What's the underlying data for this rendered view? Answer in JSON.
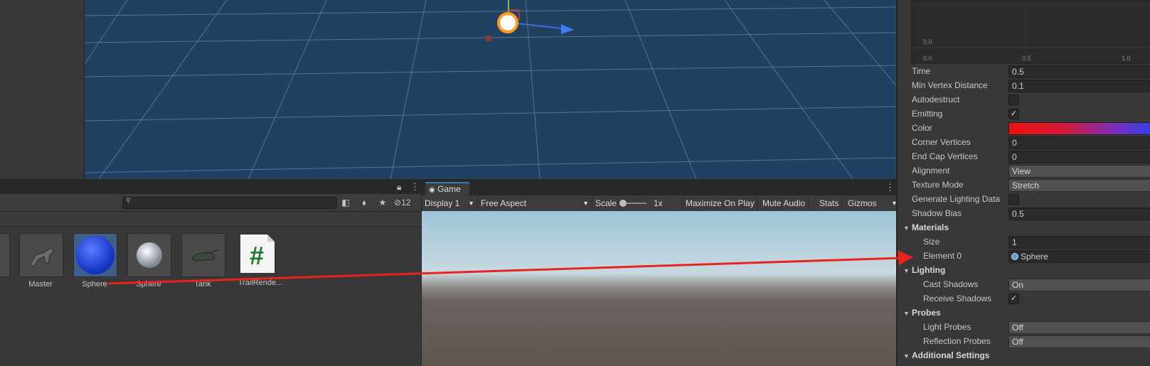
{
  "project": {
    "search": {
      "placeholder": ""
    },
    "toolbar": {
      "hidden_count": "12"
    },
    "assets": [
      {
        "name": "Master",
        "icon": "model-icon"
      },
      {
        "name": "Sphere",
        "icon": "material-sphere-blue-icon"
      },
      {
        "name": "Sphere",
        "icon": "material-sphere-white-icon"
      },
      {
        "name": "Tank",
        "icon": "model-tank-icon"
      },
      {
        "name": "TrailRende...",
        "icon": "script-icon"
      }
    ]
  },
  "game": {
    "tab_label": "Game",
    "display": "Display 1",
    "aspect": "Free Aspect",
    "scale_label": "Scale",
    "scale_value": "1x",
    "maximize": "Maximize On Play",
    "mute": "Mute Audio",
    "stats": "Stats",
    "gizmos": "Gizmos"
  },
  "inspector": {
    "curve": {
      "y_labels": [
        "0.0"
      ],
      "x_labels": [
        "0.0",
        "0.5",
        "1.0"
      ]
    },
    "time": {
      "label": "Time",
      "value": "0.5"
    },
    "min_vertex_distance": {
      "label": "Min Vertex Distance",
      "value": "0.1"
    },
    "autodestruct": {
      "label": "Autodestruct",
      "checked": false
    },
    "emitting": {
      "label": "Emitting",
      "checked": true,
      "mark": "✓"
    },
    "color": {
      "label": "Color",
      "gradient_start": "#ee1111",
      "gradient_end": "#2244ee"
    },
    "corner_vertices": {
      "label": "Corner Vertices",
      "value": "0"
    },
    "end_cap_vertices": {
      "label": "End Cap Vertices",
      "value": "0"
    },
    "alignment": {
      "label": "Alignment",
      "value": "View"
    },
    "texture_mode": {
      "label": "Texture Mode",
      "value": "Stretch"
    },
    "generate_lighting_data": {
      "label": "Generate Lighting Data",
      "checked": false
    },
    "shadow_bias": {
      "label": "Shadow Bias",
      "value": "0.5"
    },
    "materials": {
      "label": "Materials",
      "size_label": "Size",
      "size": "1",
      "element_label": "Element 0",
      "element_value": "Sphere"
    },
    "lighting": {
      "label": "Lighting",
      "cast_shadows_label": "Cast Shadows",
      "cast_shadows": "On",
      "receive_shadows_label": "Receive Shadows",
      "receive_shadows_mark": "✓"
    },
    "probes": {
      "label": "Probes",
      "light_probes_label": "Light Probes",
      "light_probes": "Off",
      "reflection_probes_label": "Reflection Probes",
      "reflection_probes": "Off"
    },
    "additional": {
      "label": "Additional Settings"
    }
  },
  "annotation": {
    "color": "#e8241c"
  }
}
